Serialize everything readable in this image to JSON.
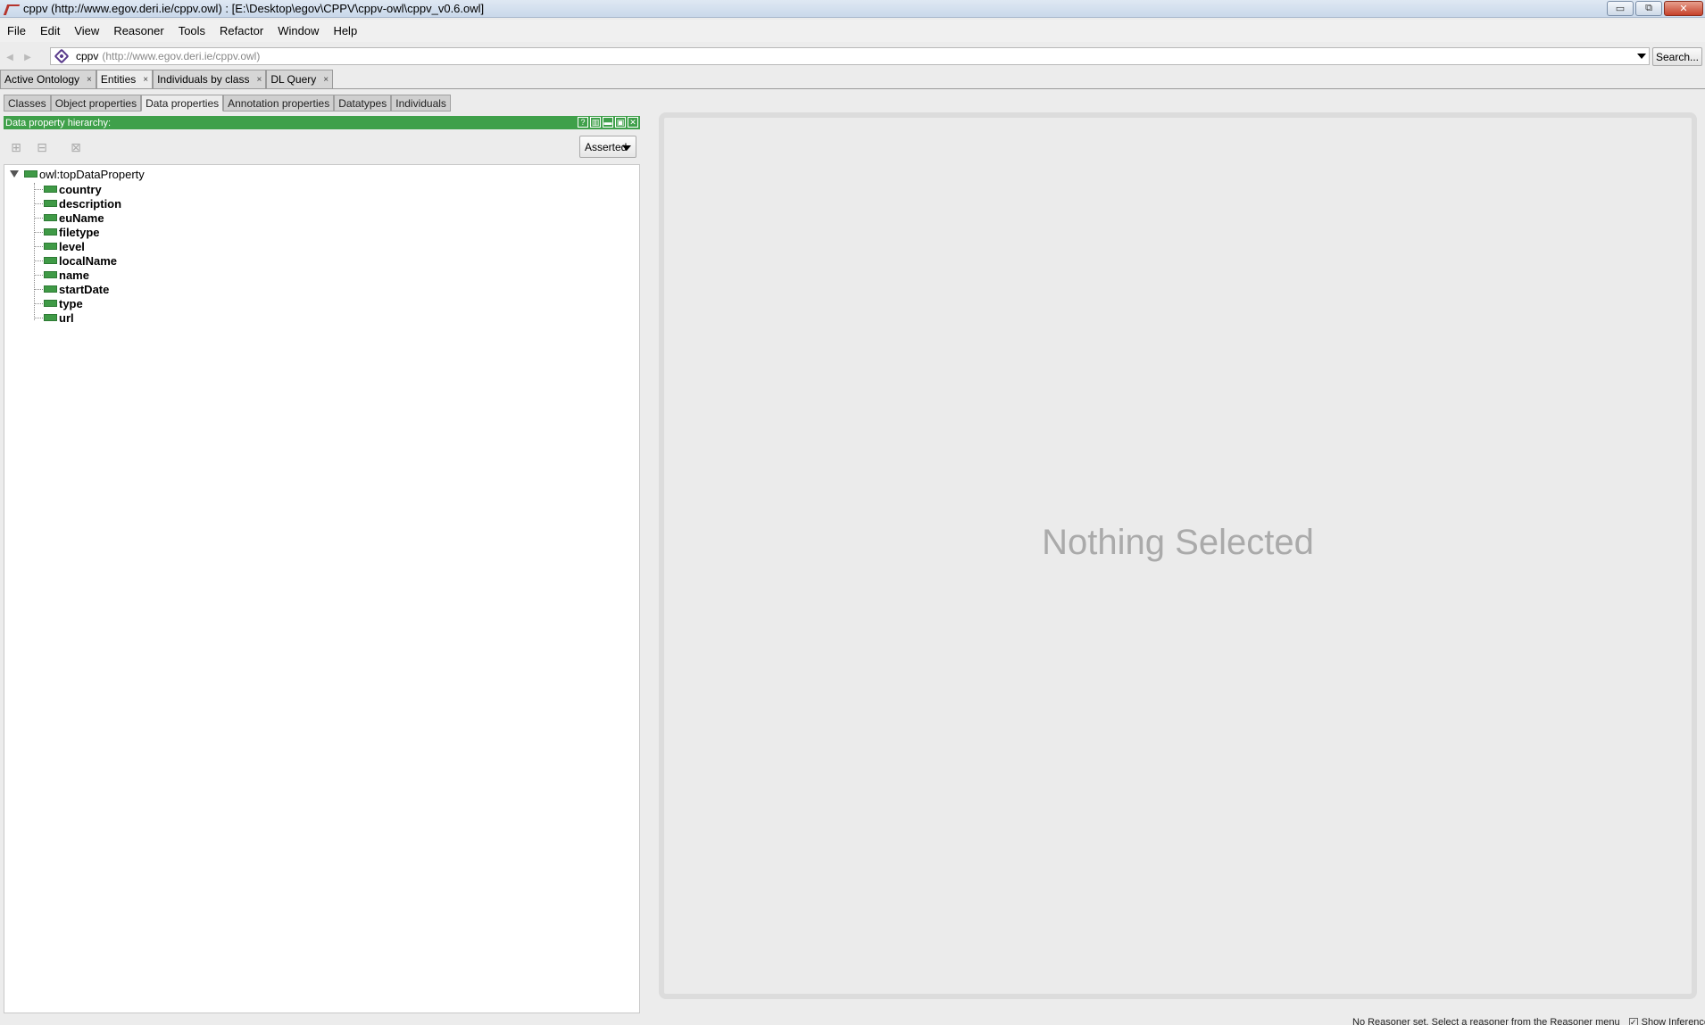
{
  "window": {
    "title": "cppv (http://www.egov.deri.ie/cppv.owl)  : [E:\\Desktop\\egov\\CPPV\\cppv-owl\\cppv_v0.6.owl]",
    "minimize": "▭",
    "maximize": "⧉",
    "close": "✕"
  },
  "menu": [
    "File",
    "Edit",
    "View",
    "Reasoner",
    "Tools",
    "Refactor",
    "Window",
    "Help"
  ],
  "address": {
    "back": "◀",
    "forward": "▶",
    "ontology_name": "cppv",
    "ontology_iri": "(http://www.egov.deri.ie/cppv.owl)",
    "search_label": "Search..."
  },
  "workspace_tabs": [
    {
      "label": "Active Ontology",
      "close": "×"
    },
    {
      "label": "Entities",
      "close": "×"
    },
    {
      "label": "Individuals by class",
      "close": "×"
    },
    {
      "label": "DL Query",
      "close": "×"
    }
  ],
  "entity_tabs": [
    "Classes",
    "Object properties",
    "Data properties",
    "Annotation properties",
    "Datatypes",
    "Individuals"
  ],
  "hierarchy_panel": {
    "title": "Data property hierarchy:",
    "controls": [
      "?",
      "▥",
      "▬",
      "▣",
      "✕"
    ],
    "mode": "Asserted",
    "root": "owl:topDataProperty",
    "children": [
      "country",
      "description",
      "euName",
      "filetype",
      "level",
      "localName",
      "name",
      "startDate",
      "type",
      "url"
    ]
  },
  "editor_panel": {
    "placeholder": "Nothing Selected"
  },
  "status": {
    "message": "No Reasoner set. Select a reasoner from the Reasoner menu",
    "check_mark": "✓",
    "show_inferences": "Show Inferences"
  },
  "colors": {
    "panel_header": "#3fa04a",
    "data_property_icon": "#3f9a46"
  }
}
